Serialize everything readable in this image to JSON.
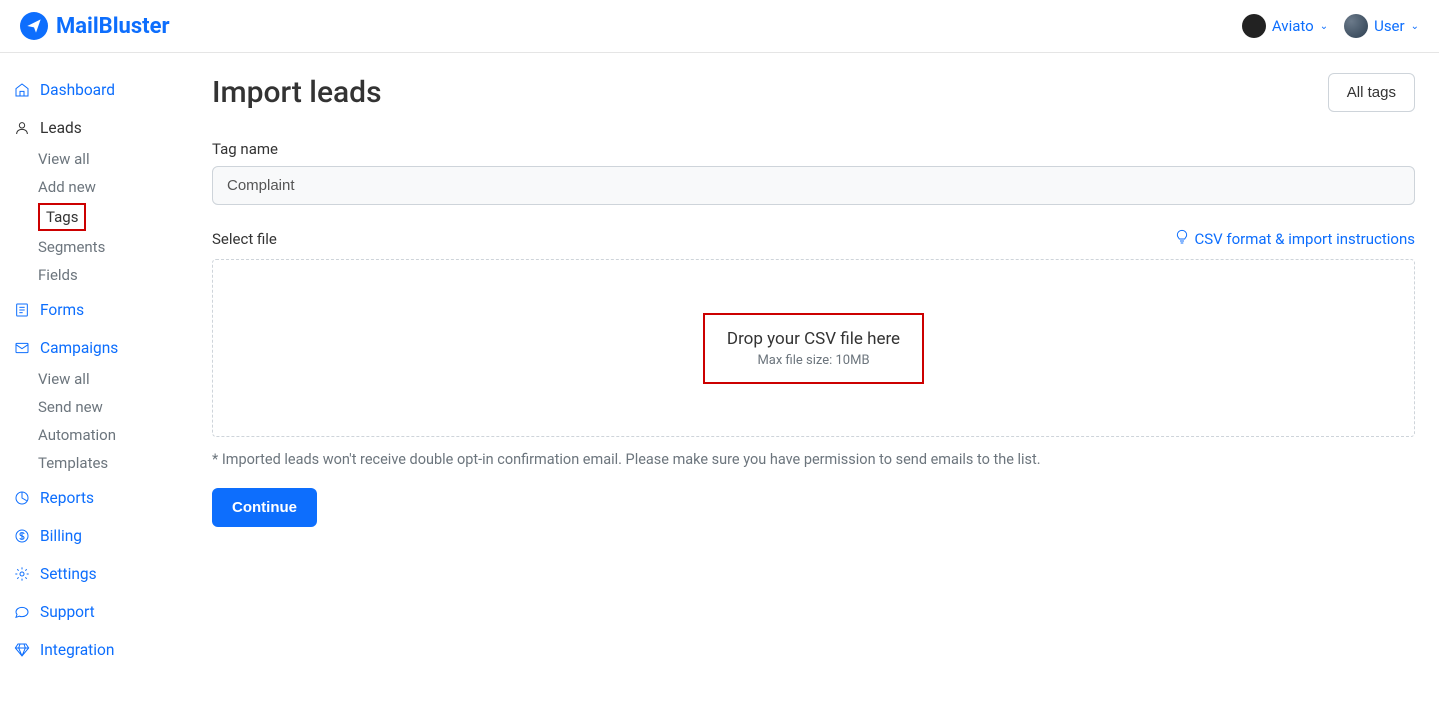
{
  "header": {
    "brand": "MailBluster",
    "workspace": "Aviato",
    "user": "User"
  },
  "sidebar": {
    "dashboard": "Dashboard",
    "leads": {
      "label": "Leads",
      "items": [
        "View all",
        "Add new",
        "Tags",
        "Segments",
        "Fields"
      ]
    },
    "forms": "Forms",
    "campaigns": {
      "label": "Campaigns",
      "items": [
        "View all",
        "Send new",
        "Automation",
        "Templates"
      ]
    },
    "reports": "Reports",
    "billing": "Billing",
    "settings": "Settings",
    "support": "Support",
    "integration": "Integration"
  },
  "page": {
    "title": "Import leads",
    "all_tags": "All tags",
    "tag_name_label": "Tag name",
    "tag_name_value": "Complaint",
    "select_file_label": "Select file",
    "csv_link": "CSV format & import instructions",
    "drop_text": "Drop your CSV file here",
    "max_size": "Max file size: 10MB",
    "note": "* Imported leads won't receive double opt-in confirmation email. Please make sure you have permission to send emails to the list.",
    "continue": "Continue"
  }
}
